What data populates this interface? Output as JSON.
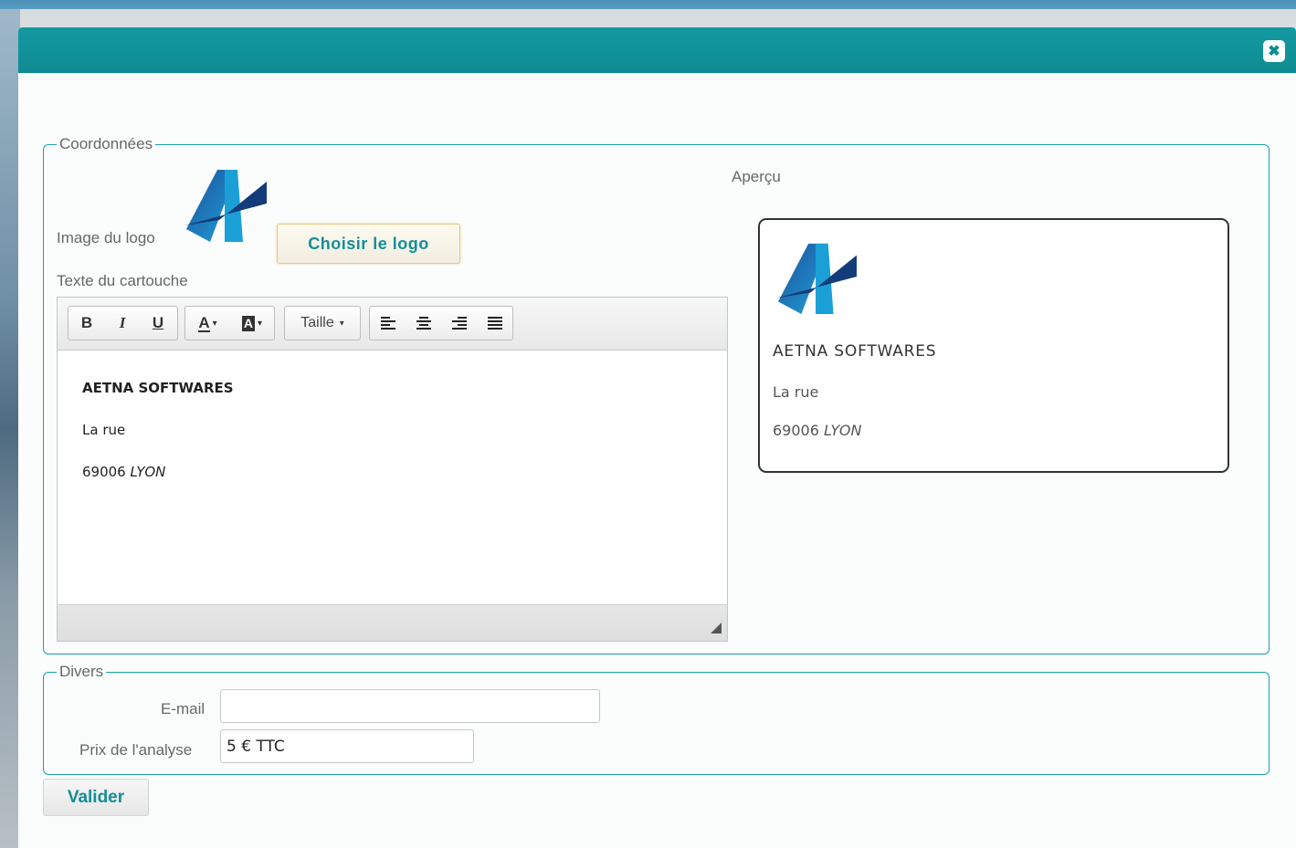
{
  "dialog": {
    "close_glyph": "✖"
  },
  "coordonnees": {
    "legend": "Coordonnées",
    "logo_label": "Image du logo",
    "choose_logo_button": "Choisir le logo",
    "cartouche_label": "Texte du cartouche",
    "apercu_label": "Aperçu",
    "toolbar": {
      "bold": "B",
      "italic": "I",
      "underline": "U",
      "font_color": "A",
      "bg_color": "A",
      "size_select": "Taille",
      "caret": "▾"
    },
    "content": {
      "company": "AETNA SOFTWARES",
      "street": "La rue",
      "postcode": "69006",
      "city": "LYON"
    }
  },
  "divers": {
    "legend": "Divers",
    "email_label": "E-mail",
    "email_value": "",
    "price_label": "Prix de l'analyse",
    "price_value": "5 € TTC"
  },
  "submit_label": "Valider",
  "colors": {
    "header": "#0e8b92",
    "accent": "#128f96",
    "border": "#18a0a6"
  },
  "icons": {
    "logo": "aetna-logo-icon",
    "close": "close-icon",
    "align_left": "align-left-icon",
    "align_center": "align-center-icon",
    "align_right": "align-right-icon",
    "align_justify": "align-justify-icon"
  }
}
